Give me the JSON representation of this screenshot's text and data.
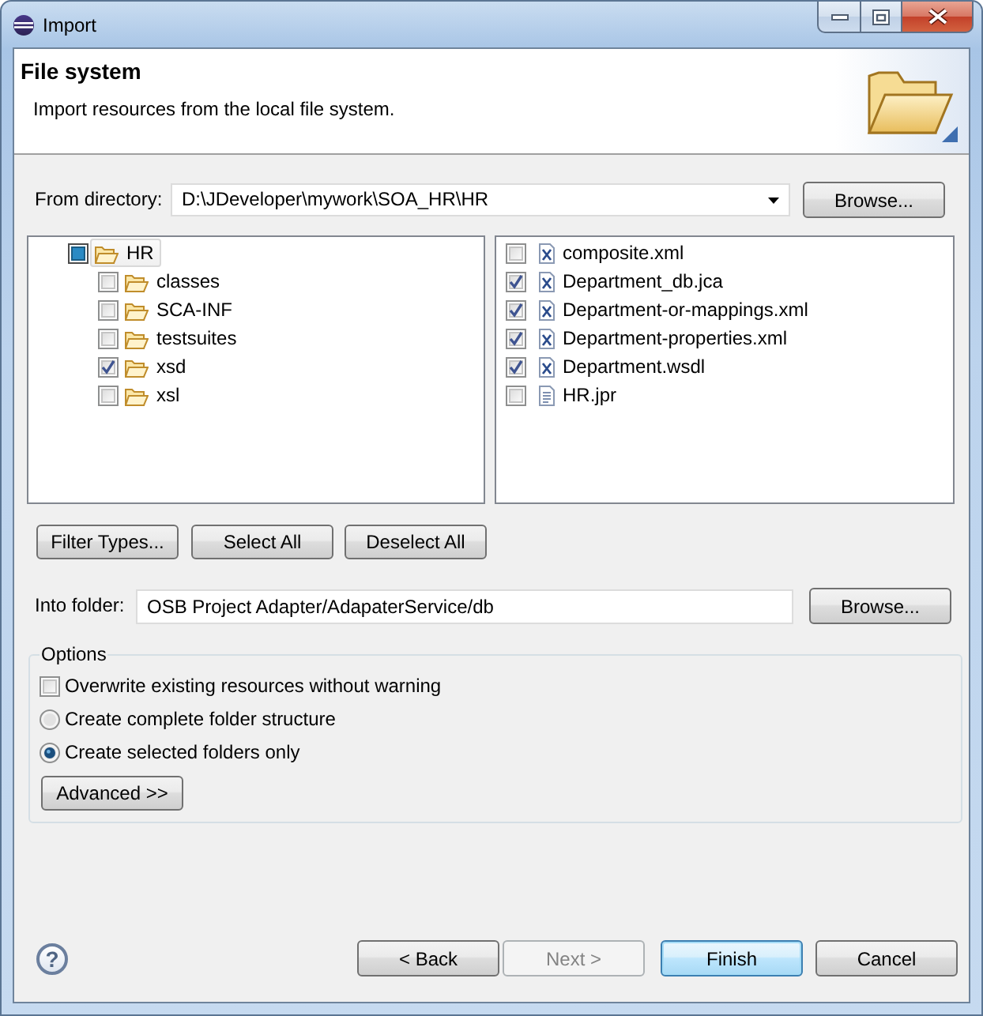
{
  "window": {
    "title": "Import"
  },
  "header": {
    "title": "File system",
    "description": "Import resources from the local file system."
  },
  "from_directory": {
    "label": "From directory:",
    "value": "D:\\JDeveloper\\mywork\\SOA_HR\\HR",
    "button": "Browse..."
  },
  "folder_tree": [
    {
      "label": "HR",
      "checked": true,
      "grayed": true,
      "selected": true,
      "children": [
        {
          "label": "classes",
          "checked": false,
          "grayed": false,
          "selected": false
        },
        {
          "label": "SCA-INF",
          "checked": false,
          "grayed": false,
          "selected": false
        },
        {
          "label": "testsuites",
          "checked": false,
          "grayed": false,
          "selected": false
        },
        {
          "label": "xsd",
          "checked": true,
          "grayed": false,
          "selected": false
        },
        {
          "label": "xsl",
          "checked": false,
          "grayed": false,
          "selected": false
        }
      ]
    }
  ],
  "files": [
    {
      "kind": "xml",
      "name": "composite.xml",
      "checked": false
    },
    {
      "kind": "xml",
      "name": "Department_db.jca",
      "checked": true
    },
    {
      "kind": "xml",
      "name": "Department-or-mappings.xml",
      "checked": true
    },
    {
      "kind": "xml",
      "name": "Department-properties.xml",
      "checked": true
    },
    {
      "kind": "xml",
      "name": "Department.wsdl",
      "checked": true
    },
    {
      "kind": "text",
      "name": "HR.jpr",
      "checked": false
    }
  ],
  "selection_buttons": [
    "Filter Types...",
    "Select All",
    "Deselect All"
  ],
  "into_folder": {
    "label": "Into folder:",
    "value": "OSB Project Adapter/AdapaterService/db",
    "button": "Browse..."
  },
  "options": {
    "title": "Options",
    "items": [
      {
        "kind": "checkbox",
        "label": "Overwrite existing resources without warning",
        "checked": false
      },
      {
        "kind": "radio",
        "label": "Create complete folder structure",
        "selected": false
      },
      {
        "kind": "radio",
        "label": "Create selected folders only",
        "selected": true
      }
    ],
    "advanced_button": "Advanced >>"
  },
  "footer": {
    "help": "?",
    "buttons": [
      {
        "label": "< Back",
        "disabled": false,
        "default": false
      },
      {
        "label": "Next >",
        "disabled": true,
        "default": false
      },
      {
        "label": "Finish",
        "disabled": false,
        "default": true
      },
      {
        "label": "Cancel",
        "disabled": false,
        "default": false
      }
    ]
  }
}
